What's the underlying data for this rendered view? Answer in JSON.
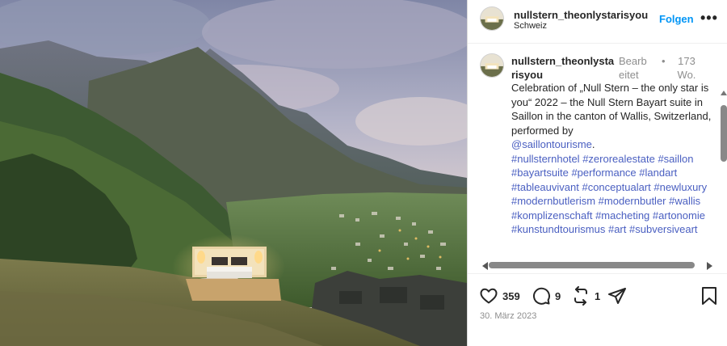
{
  "post": {
    "username": "nullstern_theonlystarisyou",
    "location": "Schweiz",
    "follow_label": "Folgen",
    "more_label": "•••"
  },
  "caption": {
    "username": "nullstern_theonlystarisyou",
    "edited_label": "Bearbeitet",
    "separator": "•",
    "time_ago": "173 Wo.",
    "text": "Celebration of „Null Stern – the only star is you“ 2022 – the Null Stern Bayart suite in Saillon in the canton of Wallis, Switzerland, performed by",
    "mention": "@saillontourisme",
    "mention_suffix": ".",
    "hashtags": [
      "#nullsternhotel",
      "#zerorealestate",
      "#saillon",
      "#bayartsuite",
      "#performance",
      "#landart",
      "#tableauvivant",
      "#conceptualart",
      "#newluxury",
      "#modernbutlerism",
      "#modernbutler",
      "#wallis",
      "#komplizenschaft",
      "#macheting",
      "#artonomie",
      "#kunstundtourismus",
      "#art",
      "#subversiveart"
    ]
  },
  "actions": {
    "likes": "359",
    "comments": "9",
    "shares": "1"
  },
  "date": "30. März 2023",
  "colors": {
    "link": "#4a5fc1",
    "follow": "#0095f6",
    "muted": "#8e8e8e"
  }
}
